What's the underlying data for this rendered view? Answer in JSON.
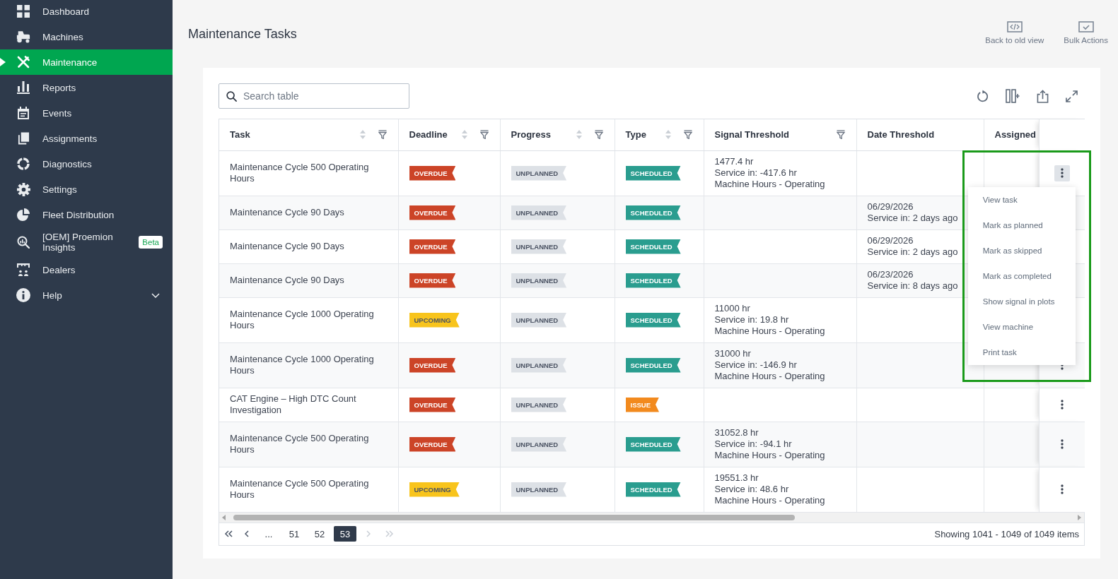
{
  "sidebar": {
    "items": [
      {
        "label": "Dashboard",
        "selected": false
      },
      {
        "label": "Machines",
        "selected": false
      },
      {
        "label": "Maintenance",
        "selected": true
      },
      {
        "label": "Reports",
        "selected": false
      },
      {
        "label": "Events",
        "selected": false
      },
      {
        "label": "Assignments",
        "selected": false
      },
      {
        "label": "Diagnostics",
        "selected": false
      },
      {
        "label": "Settings",
        "selected": false
      },
      {
        "label": "Fleet Distribution",
        "selected": false
      },
      {
        "label": "[OEM] Proemion Insights",
        "selected": false,
        "badge": "Beta"
      },
      {
        "label": "Dealers",
        "selected": false
      },
      {
        "label": "Help",
        "selected": false,
        "expanded": false
      }
    ]
  },
  "header": {
    "title": "Maintenance Tasks",
    "actions": [
      {
        "label": "Back to old view"
      },
      {
        "label": "Bulk Actions"
      }
    ]
  },
  "table": {
    "search": {
      "placeholder": "Search table"
    },
    "columns": [
      {
        "label": "Task",
        "sortable": true,
        "filterable": true
      },
      {
        "label": "Deadline",
        "sortable": true,
        "filterable": true
      },
      {
        "label": "Progress",
        "sortable": true,
        "filterable": true
      },
      {
        "label": "Type",
        "sortable": true,
        "filterable": true
      },
      {
        "label": "Signal Threshold",
        "sortable": false,
        "filterable": true
      },
      {
        "label": "Date Threshold",
        "sortable": false,
        "filterable": false
      },
      {
        "label": "Assigned",
        "sortable": false,
        "filterable": false
      }
    ],
    "rows": [
      {
        "task": "Maintenance Cycle 500 Operating Hours",
        "deadline": {
          "label": "OVERDUE",
          "color": "#cc4427"
        },
        "progress": {
          "label": "UNPLANNED",
          "color": "#dde1e6"
        },
        "type": {
          "label": "SCHEDULED",
          "color": "#2a9d8f"
        },
        "signal_threshold": [
          "1477.4 hr",
          "Service in: -417.6 hr",
          "Machine Hours - Operating"
        ],
        "menu_open": true
      },
      {
        "task": "Maintenance Cycle 90 Days",
        "deadline": {
          "label": "OVERDUE",
          "color": "#cc4427"
        },
        "progress": {
          "label": "UNPLANNED",
          "color": "#dde1e6"
        },
        "type": {
          "label": "SCHEDULED",
          "color": "#2a9d8f"
        },
        "date_threshold": [
          "06/29/2026",
          "Service in: 2 days ago"
        ],
        "menu_open": false
      },
      {
        "task": "Maintenance Cycle 90 Days",
        "deadline": {
          "label": "OVERDUE",
          "color": "#cc4427"
        },
        "progress": {
          "label": "UNPLANNED",
          "color": "#dde1e6"
        },
        "type": {
          "label": "SCHEDULED",
          "color": "#2a9d8f"
        },
        "date_threshold": [
          "06/29/2026",
          "Service in: 2 days ago"
        ],
        "menu_open": false
      },
      {
        "task": "Maintenance Cycle 90 Days",
        "deadline": {
          "label": "OVERDUE",
          "color": "#cc4427"
        },
        "progress": {
          "label": "UNPLANNED",
          "color": "#dde1e6"
        },
        "type": {
          "label": "SCHEDULED",
          "color": "#2a9d8f"
        },
        "date_threshold": [
          "06/23/2026",
          "Service in: 8 days ago"
        ],
        "menu_open": false
      },
      {
        "task": "Maintenance Cycle 1000 Operating Hours",
        "deadline": {
          "label": "UPCOMING",
          "color": "#f8c41c"
        },
        "progress": {
          "label": "UNPLANNED",
          "color": "#dde1e6"
        },
        "type": {
          "label": "SCHEDULED",
          "color": "#2a9d8f"
        },
        "signal_threshold": [
          "11000 hr",
          "Service in: 19.8 hr",
          "Machine Hours - Operating"
        ],
        "menu_open": false
      },
      {
        "task": "Maintenance Cycle 1000 Operating Hours",
        "deadline": {
          "label": "OVERDUE",
          "color": "#cc4427"
        },
        "progress": {
          "label": "UNPLANNED",
          "color": "#dde1e6"
        },
        "type": {
          "label": "SCHEDULED",
          "color": "#2a9d8f"
        },
        "signal_threshold": [
          "31000 hr",
          "Service in: -146.9 hr",
          "Machine Hours - Operating"
        ],
        "menu_open": false
      },
      {
        "task": "CAT Engine – High DTC Count Investigation",
        "deadline": {
          "label": "OVERDUE",
          "color": "#cc4427"
        },
        "progress": {
          "label": "UNPLANNED",
          "color": "#dde1e6"
        },
        "type": {
          "label": "ISSUE",
          "color": "#f28a1e"
        },
        "menu_open": false
      },
      {
        "task": "Maintenance Cycle 500 Operating Hours",
        "deadline": {
          "label": "OVERDUE",
          "color": "#cc4427"
        },
        "progress": {
          "label": "UNPLANNED",
          "color": "#dde1e6"
        },
        "type": {
          "label": "SCHEDULED",
          "color": "#2a9d8f"
        },
        "signal_threshold": [
          "31052.8 hr",
          "Service in: -94.1 hr",
          "Machine Hours - Operating"
        ],
        "menu_open": false
      },
      {
        "task": "Maintenance Cycle 500 Operating Hours",
        "deadline": {
          "label": "UPCOMING",
          "color": "#f8c41c"
        },
        "progress": {
          "label": "UNPLANNED",
          "color": "#dde1e6"
        },
        "type": {
          "label": "SCHEDULED",
          "color": "#2a9d8f"
        },
        "signal_threshold": [
          "19551.3 hr",
          "Service in: 48.6 hr",
          "Machine Hours - Operating"
        ],
        "menu_open": false
      }
    ],
    "row_menu": {
      "items": [
        "View task",
        "Mark as planned",
        "Mark as skipped",
        "Mark as completed",
        "Show signal in plots",
        "View machine",
        "Print task"
      ]
    }
  },
  "pagination": {
    "controls": [
      {
        "kind": "first",
        "disabled": false
      },
      {
        "kind": "previous",
        "disabled": false
      },
      {
        "kind": "next",
        "disabled": true
      },
      {
        "kind": "last",
        "disabled": true
      }
    ],
    "pages": [
      {
        "label": "...",
        "selected": false
      },
      {
        "label": "51",
        "selected": false
      },
      {
        "label": "52",
        "selected": false
      },
      {
        "label": "53",
        "selected": true
      }
    ],
    "summary": "Showing 1041 - 1049 of 1049 items"
  }
}
